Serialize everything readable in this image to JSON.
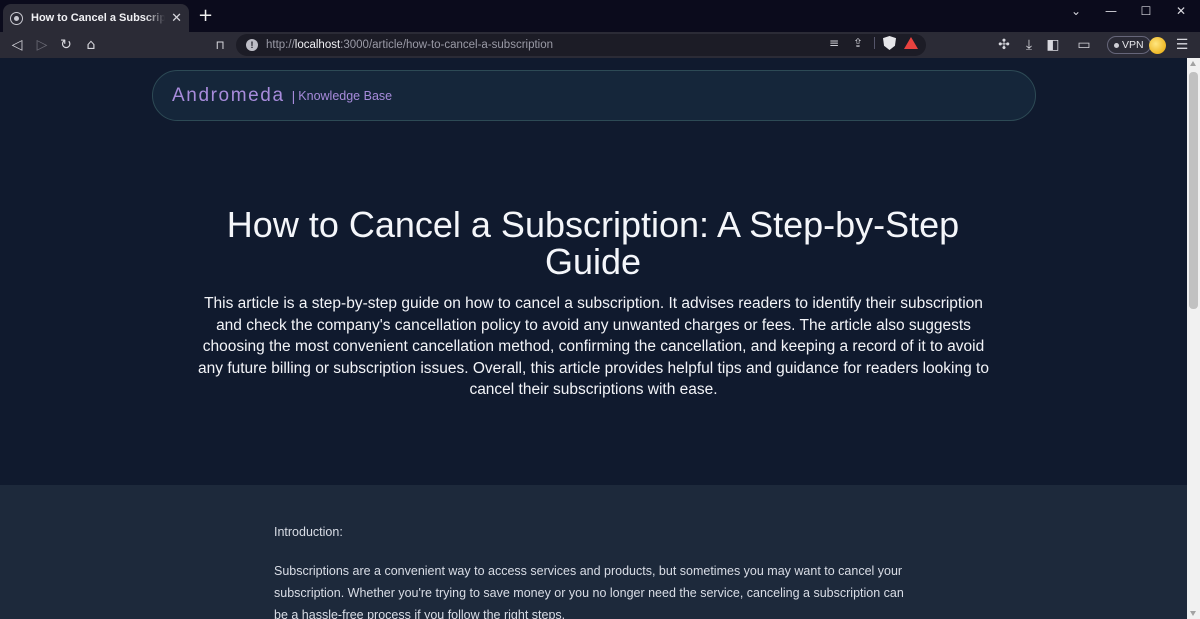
{
  "browser": {
    "tab": {
      "title": "How to Cancel a Subscription: A Step-by-Step Guide"
    },
    "url": {
      "scheme": "http://",
      "host": "localhost",
      "rest": ":3000/article/how-to-cancel-a-subscription"
    },
    "vpn_label": "VPN",
    "icons": {
      "favicon": "globe-icon",
      "tab_close": "close-icon",
      "new_tab": "plus-icon",
      "back": "back-icon",
      "forward": "forward-icon",
      "reload": "reload-icon",
      "home": "home-icon",
      "bookmark": "bookmark-icon",
      "site_info": "info-icon",
      "reader": "reader-mode-icon",
      "share": "share-icon",
      "brave_shields": "brave-shields-icon",
      "brave_rewards": "brave-rewards-icon",
      "extensions": "puzzle-icon",
      "downloads": "download-icon",
      "sidebar": "sidebar-icon",
      "wallet": "wallet-icon",
      "menu": "hamburger-menu-icon",
      "tab_search": "chevron-down-icon",
      "minimize": "minimize-icon",
      "maximize": "maximize-icon",
      "close_window": "close-window-icon"
    }
  },
  "site": {
    "brand": "Andromeda",
    "separator": "|",
    "subtitle": "Knowledge Base",
    "brand_color": "#a78bdb"
  },
  "article": {
    "title": "How to Cancel a Subscription: A Step-by-Step Guide",
    "summary": "This article is a step-by-step guide on how to cancel a subscription. It advises readers to identify their subscription and check the company's cancellation policy to avoid any unwanted charges or fees. The article also suggests choosing the most convenient cancellation method, confirming the cancellation, and keeping a record of it to avoid any future billing or subscription issues. Overall, this article provides helpful tips and guidance for readers looking to cancel their subscriptions with ease.",
    "intro_heading": "Introduction:",
    "intro_text": "Subscriptions are a convenient way to access services and products, but sometimes you may want to cancel your subscription. Whether you're trying to save money or you no longer need the service, canceling a subscription can be a hassle-free process if you follow the right steps."
  }
}
